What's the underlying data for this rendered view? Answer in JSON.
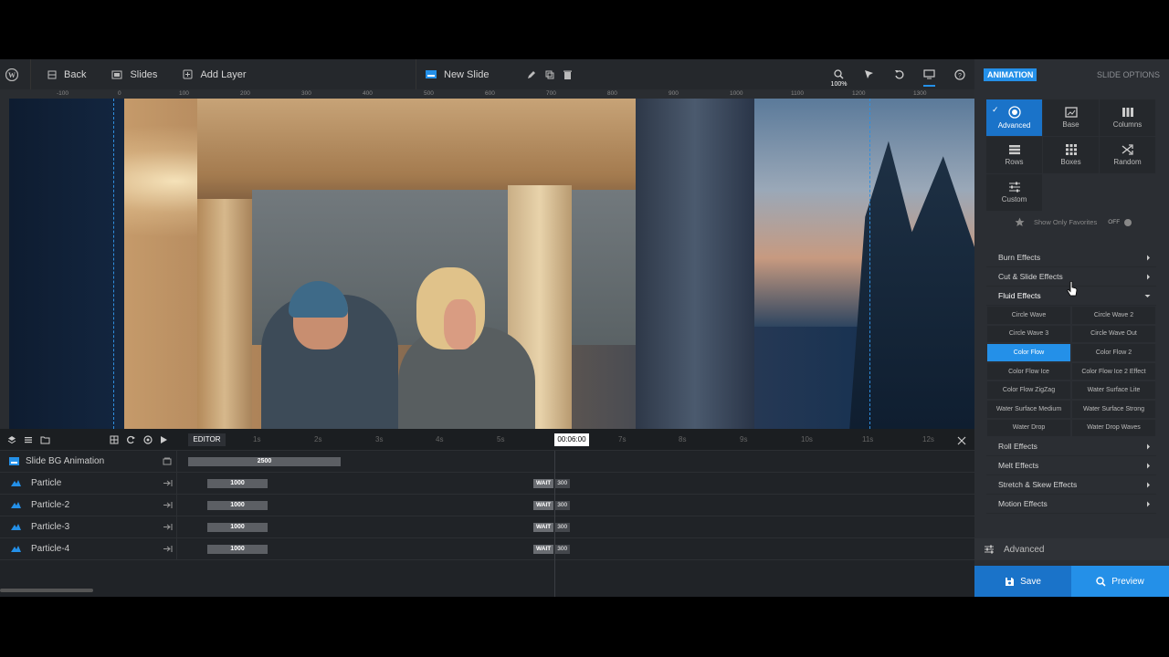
{
  "toolbar": {
    "back_label": "Back",
    "slides_label": "Slides",
    "add_layer_label": "Add Layer",
    "slide_name": "New Slide",
    "zoom_level": "100%"
  },
  "ruler_labels": [
    "-100",
    "0",
    "100",
    "200",
    "300",
    "400",
    "500",
    "600",
    "700",
    "800",
    "900",
    "1000",
    "1100",
    "1200",
    "1300"
  ],
  "timeline": {
    "editor_tab": "EDITOR",
    "scale": [
      "1s",
      "2s",
      "3s",
      "4s",
      "5s",
      "7s",
      "8s",
      "9s",
      "10s",
      "11s",
      "12s"
    ],
    "current_time": "00:06:00",
    "rows": [
      {
        "name": "Slide BG Animation",
        "duration": "2500"
      },
      {
        "name": "Particle",
        "duration": "1000",
        "wait_label": "WAIT",
        "wait_value": "300"
      },
      {
        "name": "Particle-2",
        "duration": "1000",
        "wait_label": "WAIT",
        "wait_value": "300"
      },
      {
        "name": "Particle-3",
        "duration": "1000",
        "wait_label": "WAIT",
        "wait_value": "300"
      },
      {
        "name": "Particle-4",
        "duration": "1000",
        "wait_label": "WAIT",
        "wait_value": "300"
      }
    ]
  },
  "sidebar": {
    "tab_animation": "ANIMATION",
    "tab_slide_options": "SLIDE OPTIONS",
    "buttons": [
      "Advanced",
      "Base",
      "Columns",
      "Rows",
      "Boxes",
      "Random",
      "Custom"
    ],
    "favorites_label": "Show Only Favorites",
    "favorites_toggle": "OFF",
    "effect_groups": {
      "burn": "Burn Effects",
      "cut": "Cut & Slide Effects",
      "fluid": "Fluid Effects",
      "roll": "Roll Effects",
      "melt": "Melt Effects",
      "stretch": "Stretch & Skew Effects",
      "motion": "Motion Effects"
    },
    "fluid_effects": [
      "Circle Wave",
      "Circle Wave 2",
      "Circle Wave 3",
      "Circle Wave Out",
      "Color Flow",
      "Color Flow 2",
      "Color Flow Ice",
      "Color Flow Ice 2 Effect",
      "Color Flow ZigZag",
      "Water Surface Lite",
      "Water Surface Medium",
      "Water Surface Strong",
      "Water Drop",
      "Water Drop Waves"
    ],
    "advanced_label": "Advanced",
    "save_label": "Save",
    "preview_label": "Preview"
  },
  "colors": {
    "accent": "#2490e8",
    "accent_dark": "#1a73c9",
    "panel": "#2b2e33",
    "background": "#1d2024"
  }
}
